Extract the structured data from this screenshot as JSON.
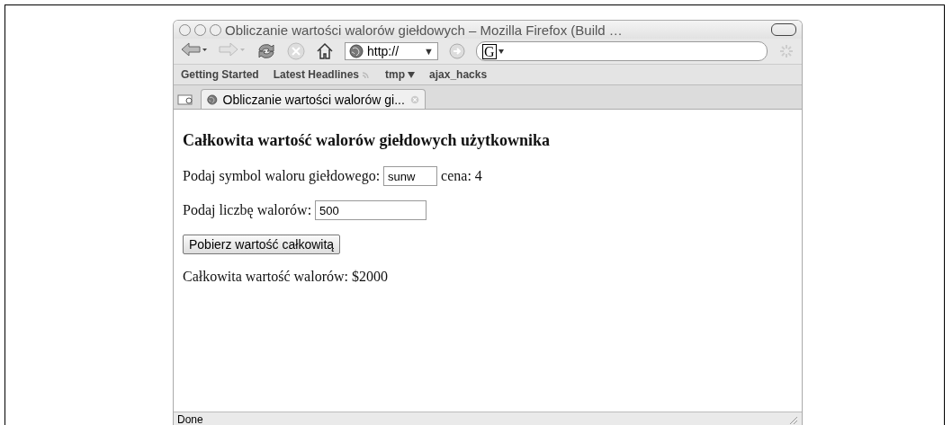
{
  "window": {
    "title": "Obliczanie wartości walorów giełdowych – Mozilla Firefox (Build …"
  },
  "toolbar": {
    "back_enabled": true,
    "forward_enabled": false,
    "stop_enabled": false,
    "url": "http://",
    "url_dropdown": "▼",
    "search_engine": "G"
  },
  "bookmarks": [
    {
      "label": "Getting Started",
      "kind": "plain"
    },
    {
      "label": "Latest Headlines",
      "kind": "feed"
    },
    {
      "label": "tmp",
      "kind": "folder"
    },
    {
      "label": "ajax_hacks",
      "kind": "plain"
    }
  ],
  "tab": {
    "title": "Obliczanie wartości walorów gi..."
  },
  "content": {
    "heading": "Całkowita wartość walorów giełdowych użytkownika",
    "symbol_label": "Podaj symbol waloru giełdowego:",
    "symbol_value": "sunw",
    "price": "cena: 4",
    "count_label": "Podaj liczbę walorów:",
    "count_value": "500",
    "button": "Pobierz wartość całkowitą",
    "result": "Całkowita wartość walorów: $2000"
  },
  "status_bar": {
    "text": "Done"
  }
}
